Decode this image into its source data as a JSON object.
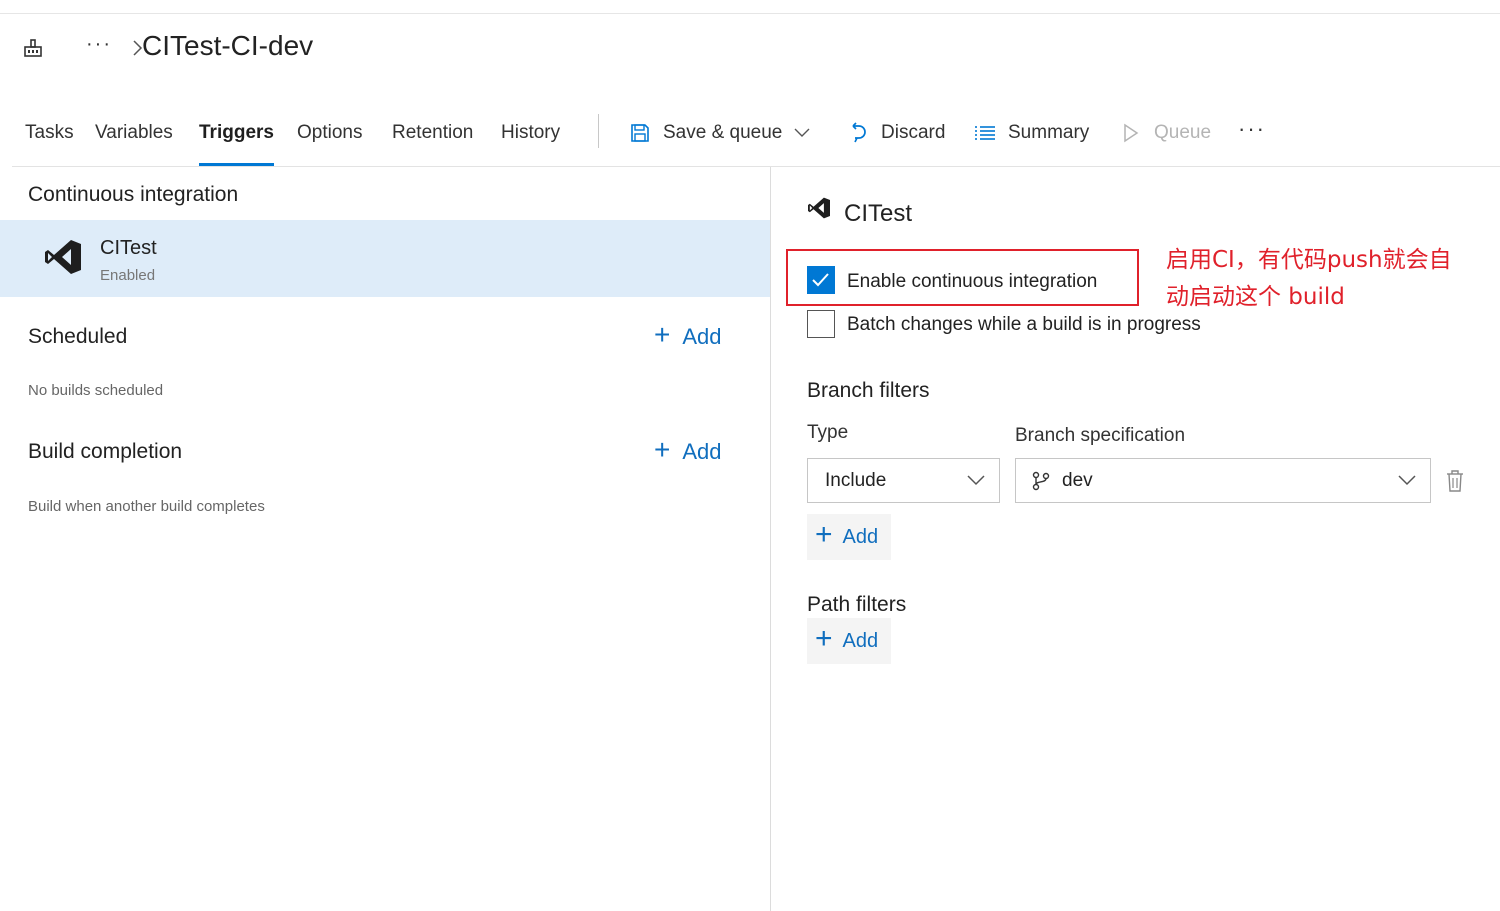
{
  "header": {
    "title": "CITest-CI-dev",
    "ellipsis": "···"
  },
  "tabs": [
    {
      "label": "Tasks"
    },
    {
      "label": "Variables"
    },
    {
      "label": "Triggers",
      "active": true
    },
    {
      "label": "Options"
    },
    {
      "label": "Retention"
    },
    {
      "label": "History"
    }
  ],
  "toolbar": {
    "save_queue": "Save & queue",
    "discard": "Discard",
    "summary": "Summary",
    "queue": "Queue",
    "more": "···"
  },
  "left": {
    "ci_title": "Continuous integration",
    "ci_item": {
      "name": "CITest",
      "status": "Enabled"
    },
    "scheduled_title": "Scheduled",
    "scheduled_add": "Add",
    "scheduled_empty": "No builds scheduled",
    "completion_title": "Build completion",
    "completion_add": "Add",
    "completion_desc": "Build when another build completes"
  },
  "right": {
    "repo_name": "CITest",
    "enable_ci_label": "Enable continuous integration",
    "enable_ci_checked": true,
    "batch_label": "Batch changes while a build is in progress",
    "batch_checked": false,
    "annotation": "启用CI，有代码push就会自动启动这个 build",
    "branch_filters_title": "Branch filters",
    "type_label": "Type",
    "branch_spec_label": "Branch specification",
    "type_value": "Include",
    "branch_value": "dev",
    "branch_add": "Add",
    "path_filters_title": "Path filters",
    "path_add": "Add"
  },
  "colors": {
    "accent": "#0078d4",
    "link": "#106ebe",
    "selected_row": "#deecf9",
    "annotation_red": "#e0212b"
  }
}
